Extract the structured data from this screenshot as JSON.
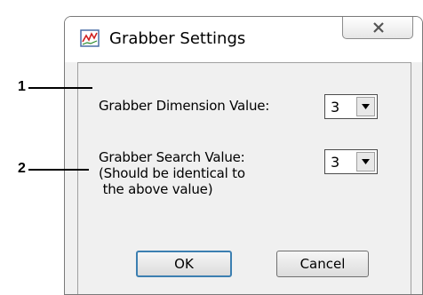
{
  "window": {
    "title": "Grabber Settings",
    "icon": "chart-app-icon",
    "close_icon": "close-x-icon"
  },
  "fields": {
    "dimension": {
      "label": "Grabber Dimension Value:",
      "value": "3"
    },
    "search": {
      "label_lines": [
        "Grabber Search Value:",
        "(Should be identical to",
        " the above value)"
      ],
      "value": "3"
    }
  },
  "buttons": {
    "ok": "OK",
    "cancel": "Cancel"
  },
  "callouts": [
    "1",
    "2"
  ]
}
